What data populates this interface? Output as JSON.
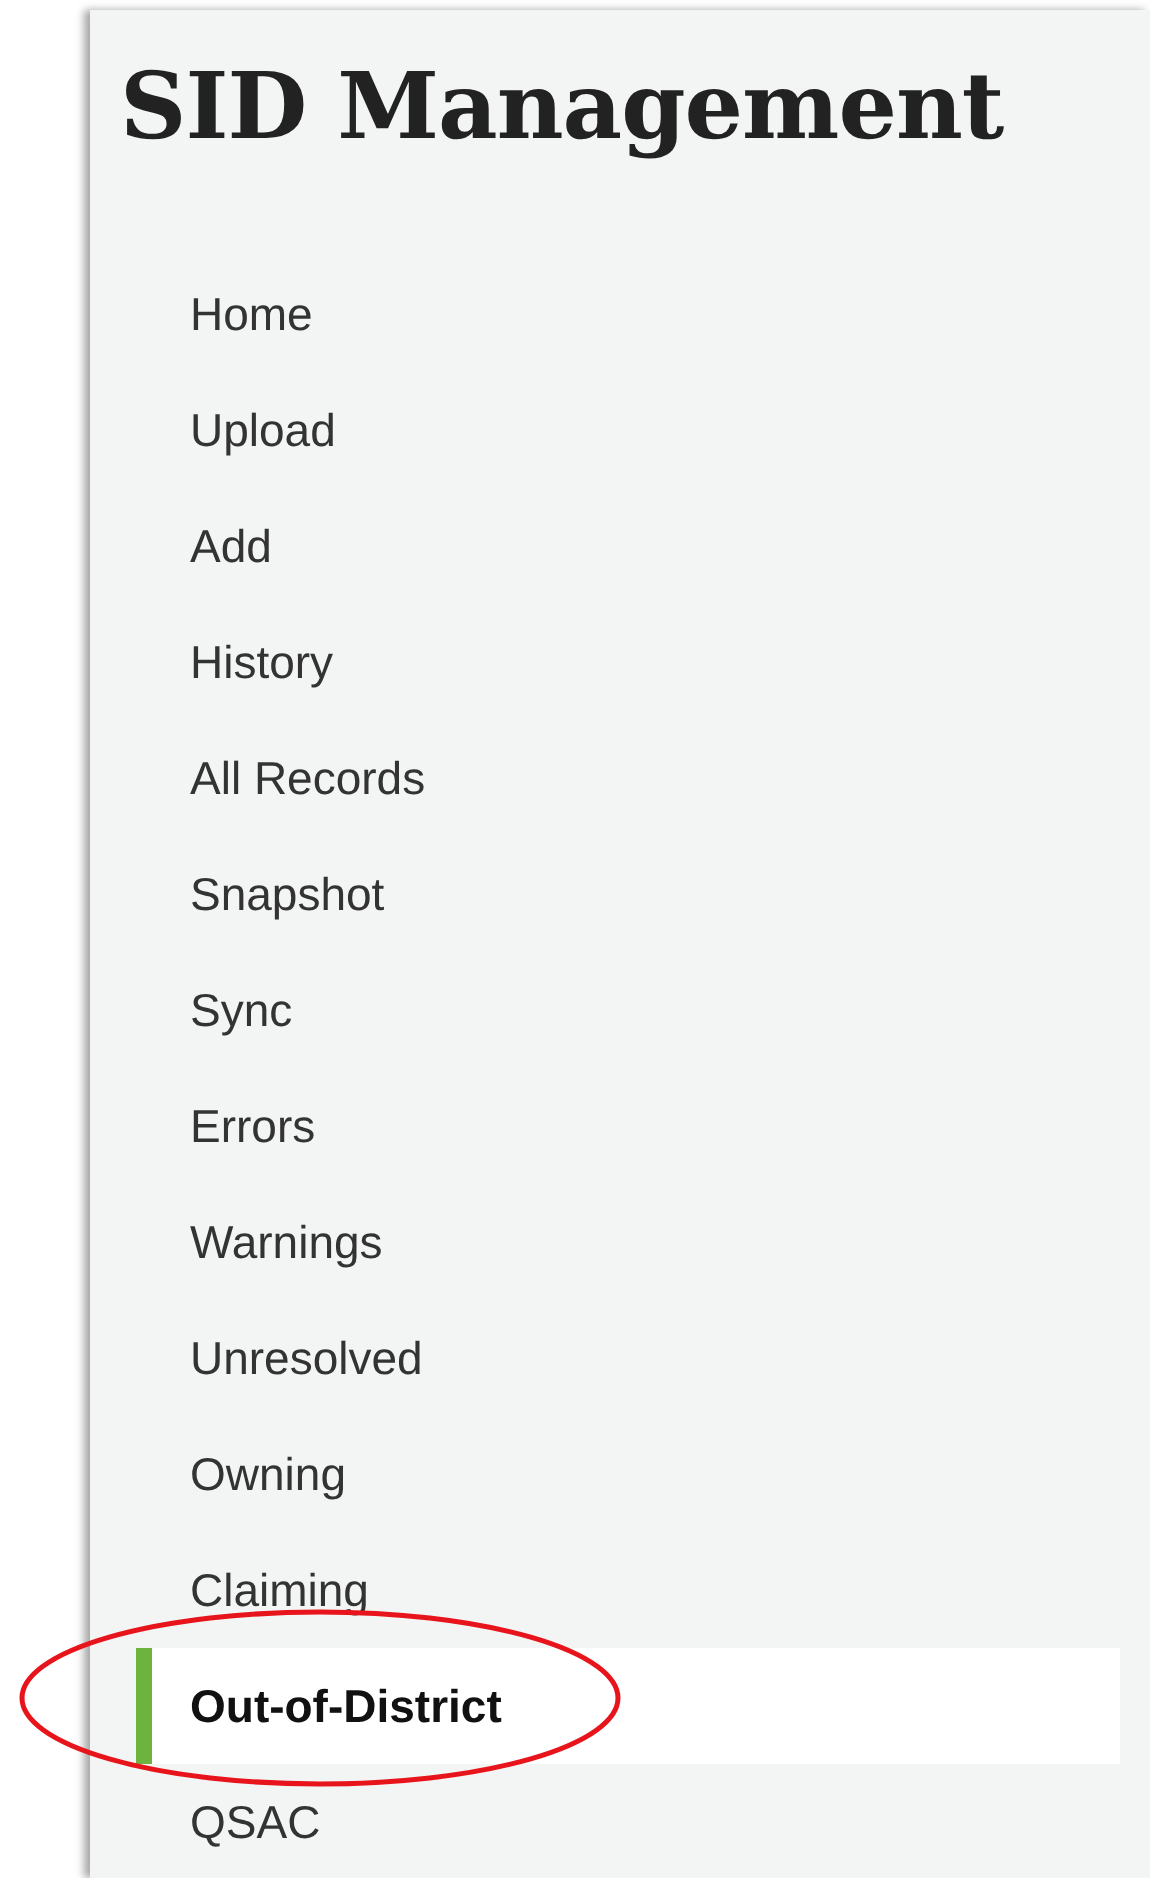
{
  "title": "SID Management",
  "nav_items": [
    {
      "label": "Home",
      "selected": false
    },
    {
      "label": "Upload",
      "selected": false
    },
    {
      "label": "Add",
      "selected": false
    },
    {
      "label": "History",
      "selected": false
    },
    {
      "label": "All Records",
      "selected": false
    },
    {
      "label": "Snapshot",
      "selected": false
    },
    {
      "label": "Sync",
      "selected": false
    },
    {
      "label": "Errors",
      "selected": false
    },
    {
      "label": "Warnings",
      "selected": false
    },
    {
      "label": "Unresolved",
      "selected": false
    },
    {
      "label": "Owning",
      "selected": false
    },
    {
      "label": "Claiming",
      "selected": false
    },
    {
      "label": "Out-of-District",
      "selected": true,
      "circled": true
    },
    {
      "label": "QSAC",
      "selected": false
    }
  ]
}
